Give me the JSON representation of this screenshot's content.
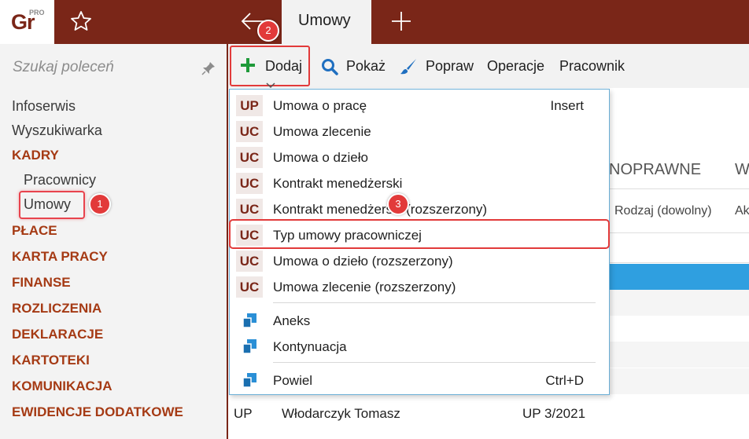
{
  "app": {
    "logo_text": "Gr",
    "logo_superscript": "PRO",
    "active_tab": "Umowy"
  },
  "sidebar": {
    "search_placeholder": "Szukaj poleceń",
    "items": [
      {
        "label": "Infoserwis",
        "kind": "link"
      },
      {
        "label": "Wyszukiwarka",
        "kind": "link"
      },
      {
        "label": "KADRY",
        "kind": "category"
      },
      {
        "label": "Pracownicy",
        "kind": "sub"
      },
      {
        "label": "Umowy",
        "kind": "sub"
      },
      {
        "label": "PŁACE",
        "kind": "category"
      },
      {
        "label": "KARTA PRACY",
        "kind": "category"
      },
      {
        "label": "FINANSE",
        "kind": "category"
      },
      {
        "label": "ROZLICZENIA",
        "kind": "category"
      },
      {
        "label": "DEKLARACJE",
        "kind": "category"
      },
      {
        "label": "KARTOTEKI",
        "kind": "category"
      },
      {
        "label": "KOMUNIKACJA",
        "kind": "category"
      },
      {
        "label": "EWIDENCJE DODATKOWE",
        "kind": "category"
      }
    ]
  },
  "toolbar": {
    "add_label": "Dodaj",
    "show_label": "Pokaż",
    "edit_label": "Popraw",
    "operations_label": "Operacje",
    "employee_label": "Pracownik"
  },
  "badges": {
    "b1": "1",
    "b2": "2",
    "b3": "3"
  },
  "grid": {
    "header_group": "NOPRAWNE",
    "header_group2": "W",
    "col_type": "Rodzaj (dowolny)",
    "col_type2": "Ak",
    "last_row": {
      "code": "UP",
      "name": "Włodarczyk Tomasz",
      "number": "UP 3/2021"
    }
  },
  "dropdown": {
    "items": [
      {
        "code": "UP",
        "label": "Umowa o pracę",
        "shortcut": "Insert"
      },
      {
        "code": "UC",
        "label": "Umowa zlecenie",
        "shortcut": ""
      },
      {
        "code": "UC",
        "label": "Umowa o dzieło",
        "shortcut": ""
      },
      {
        "code": "UC",
        "label": "Kontrakt menedżerski",
        "shortcut": ""
      },
      {
        "code": "UC",
        "label": "Kontrakt menedżerski (rozszerzony)",
        "shortcut": ""
      },
      {
        "code": "UC",
        "label": "Typ umowy pracowniczej",
        "shortcut": ""
      },
      {
        "code": "UC",
        "label": "Umowa o dzieło (rozszerzony)",
        "shortcut": ""
      },
      {
        "code": "UC",
        "label": "Umowa zlecenie (rozszerzony)",
        "shortcut": ""
      }
    ],
    "extra_items": [
      {
        "label": "Aneks",
        "icon": "document-stack-icon",
        "shortcut": ""
      },
      {
        "label": "Kontynuacja",
        "icon": "document-stack-icon",
        "shortcut": ""
      },
      {
        "label": "Powiel",
        "icon": "document-stack-icon",
        "shortcut": "Ctrl+D"
      }
    ]
  },
  "colors": {
    "brand": "#7a2618",
    "highlight": "#e23a3a",
    "selection": "#2f9fe0"
  }
}
